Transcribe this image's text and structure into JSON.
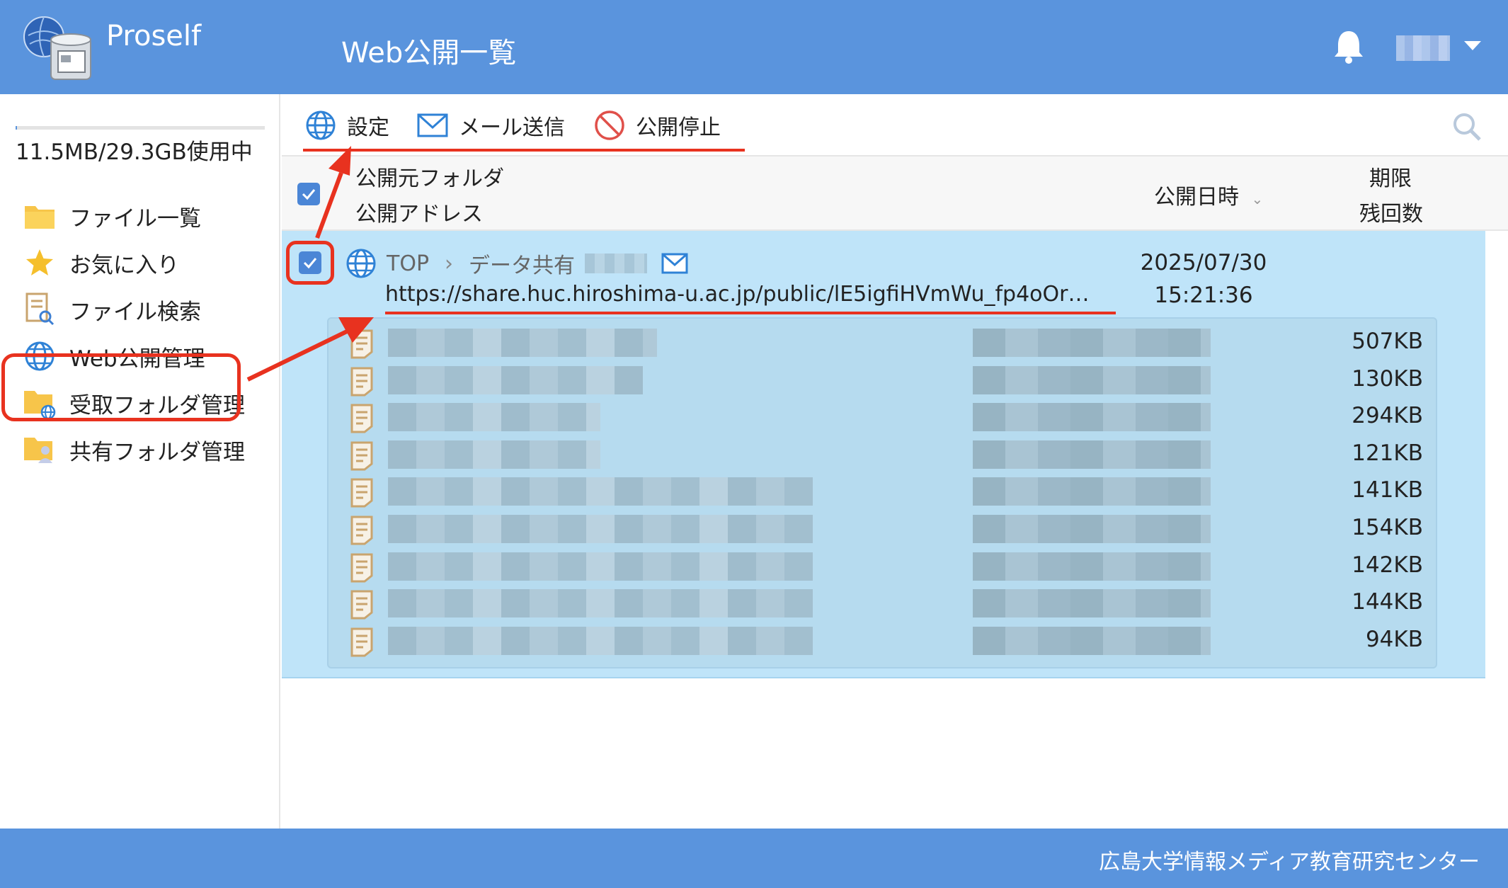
{
  "header": {
    "app_name": "Proself",
    "page_title": "Web公開一覧"
  },
  "sidebar": {
    "usage_text": "11.5MB/29.3GB使用中",
    "usage_fraction": 0.0004,
    "items": [
      {
        "label": "ファイル一覧",
        "icon": "folder-icon"
      },
      {
        "label": "お気に入り",
        "icon": "star-icon"
      },
      {
        "label": "ファイル検索",
        "icon": "file-search-icon"
      },
      {
        "label": "Web公開管理",
        "icon": "globe-icon",
        "active": true
      },
      {
        "label": "受取フォルダ管理",
        "icon": "receive-folder-icon"
      },
      {
        "label": "共有フォルダ管理",
        "icon": "shared-folder-icon"
      }
    ]
  },
  "toolbar": {
    "settings_label": "設定",
    "mail_label": "メール送信",
    "stop_label": "公開停止"
  },
  "table": {
    "header": {
      "source_folder": "公開元フォルダ",
      "public_address": "公開アドレス",
      "publish_date": "公開日時",
      "expiry": "期限",
      "remaining": "残回数"
    },
    "row": {
      "crumb_root": "TOP",
      "crumb_folder": "データ共有",
      "url": "https://share.huc.hiroshima-u.ac.jp/public/lE5igfiHVmWu_fp4oOr…",
      "date": "2025/07/30",
      "time": "15:21:36",
      "checked": true
    },
    "files": [
      {
        "size": "507KB"
      },
      {
        "size": "130KB"
      },
      {
        "size": "294KB"
      },
      {
        "size": "121KB"
      },
      {
        "size": "141KB"
      },
      {
        "size": "154KB"
      },
      {
        "size": "142KB"
      },
      {
        "size": "144KB"
      },
      {
        "size": "94KB"
      }
    ]
  },
  "footer": {
    "text": "広島大学情報メディア教育研究センター"
  },
  "colors": {
    "header_bg": "#5a94dd",
    "selection_bg": "#bfe4f9",
    "annotation": "#e8321f"
  }
}
